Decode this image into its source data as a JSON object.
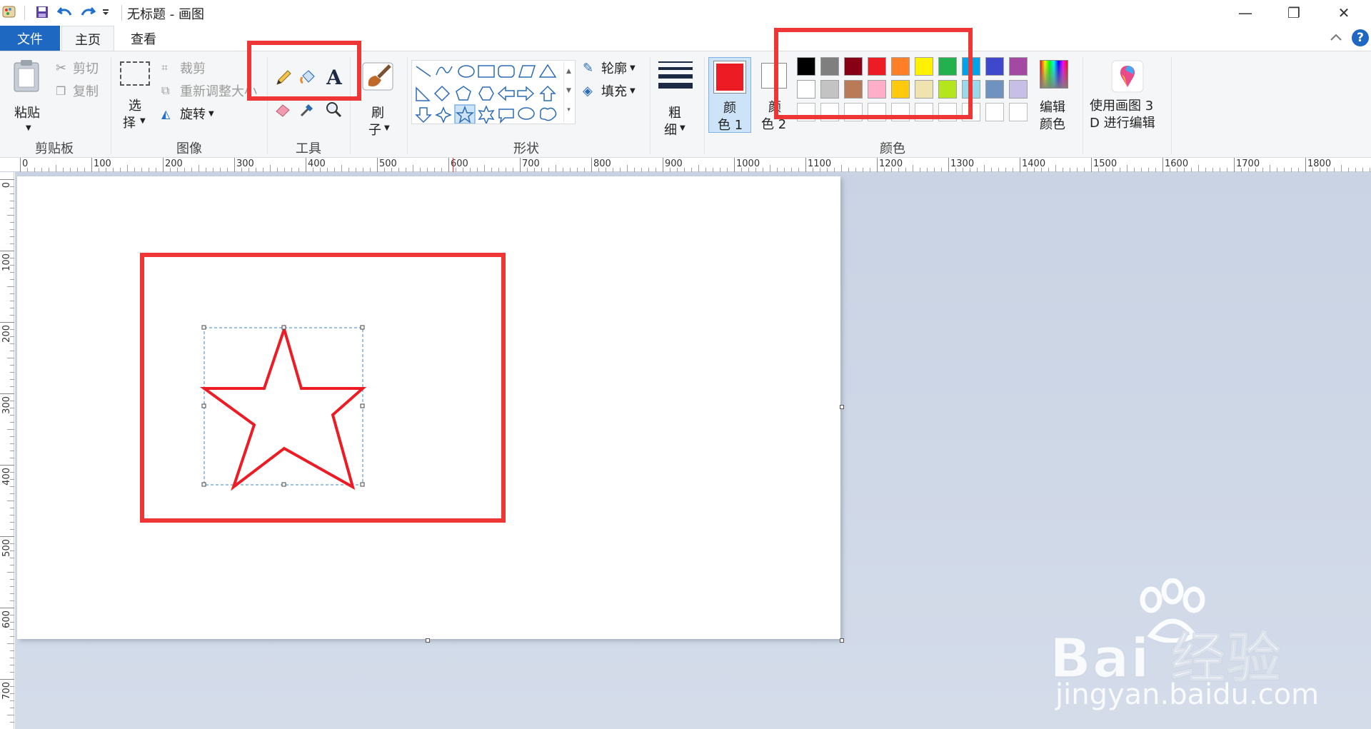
{
  "window": {
    "title": "无标题 - 画图",
    "min": "—",
    "max": "❐",
    "close": "✕"
  },
  "tabs": {
    "file": "文件",
    "home": "主页",
    "view": "查看"
  },
  "clipboard": {
    "paste": "粘贴",
    "cut": "剪切",
    "copy": "复制",
    "group": "剪贴板"
  },
  "image": {
    "select_1": "选",
    "select_2": "择",
    "crop": "裁剪",
    "resize": "重新调整大小",
    "rotate": "旋转",
    "group": "图像"
  },
  "tools": {
    "group": "工具",
    "text_glyph": "A"
  },
  "brushes": {
    "label_1": "刷",
    "label_2": "子"
  },
  "shapes": {
    "outline": "轮廓",
    "fill": "填充",
    "group": "形状"
  },
  "size": {
    "label_1": "粗",
    "label_2": "细"
  },
  "colors": {
    "color1_1": "颜",
    "color1_2": "色 1",
    "color2_1": "颜",
    "color2_2": "色 2",
    "edit_1": "编辑",
    "edit_2": "颜色",
    "group": "颜色",
    "color1_value": "#ed1c24",
    "color2_value": "#ffffff",
    "palette_row1": [
      "#000000",
      "#7f7f7f",
      "#880015",
      "#ed1c24",
      "#ff7f27",
      "#fff200",
      "#22b14c",
      "#00a2e8",
      "#3f48cc",
      "#a349a4"
    ],
    "palette_row2": [
      "#ffffff",
      "#c3c3c3",
      "#b97a57",
      "#ffaec9",
      "#ffc90e",
      "#efe4b0",
      "#b5e61d",
      "#99d9ea",
      "#7092be",
      "#c8bfe7"
    ]
  },
  "paint3d": {
    "label_1": "使用画图 3",
    "label_2": "D 进行编辑"
  },
  "ruler": {
    "h": [
      "0",
      "100",
      "200",
      "300",
      "400",
      "500",
      "600",
      "700",
      "800",
      "900",
      "1000",
      "1100",
      "1200",
      "1300",
      "1400",
      "1500",
      "1600",
      "1700",
      "1800"
    ],
    "v": [
      "0",
      "100",
      "200",
      "300",
      "400",
      "500",
      "600",
      "700"
    ]
  },
  "watermark": {
    "brand": "Bai  经验",
    "url": "jingyan.baidu.com"
  },
  "accent": "#ef3636"
}
